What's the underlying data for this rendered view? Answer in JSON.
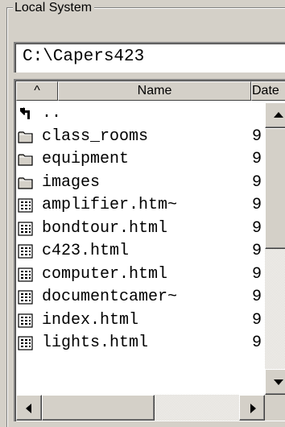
{
  "panel": {
    "title": "Local System",
    "path": "C:\\Capers423"
  },
  "columns": {
    "sort_indicator": "^",
    "name": "Name",
    "date": "Date"
  },
  "rows": [
    {
      "name": "..",
      "icon": "up-folder-icon",
      "date": ""
    },
    {
      "name": "class_rooms",
      "icon": "folder-icon",
      "date": "9"
    },
    {
      "name": "equipment",
      "icon": "folder-icon",
      "date": "9"
    },
    {
      "name": "images",
      "icon": "folder-icon",
      "date": "9"
    },
    {
      "name": "amplifier.htm~",
      "icon": "file-icon",
      "date": "9"
    },
    {
      "name": "bondtour.html",
      "icon": "file-icon",
      "date": "9"
    },
    {
      "name": "c423.html",
      "icon": "file-icon",
      "date": "9"
    },
    {
      "name": "computer.html",
      "icon": "file-icon",
      "date": "9"
    },
    {
      "name": "documentcamer~",
      "icon": "file-icon",
      "date": "9"
    },
    {
      "name": "index.html",
      "icon": "file-icon",
      "date": "9"
    },
    {
      "name": "lights.html",
      "icon": "file-icon",
      "date": "9"
    }
  ]
}
